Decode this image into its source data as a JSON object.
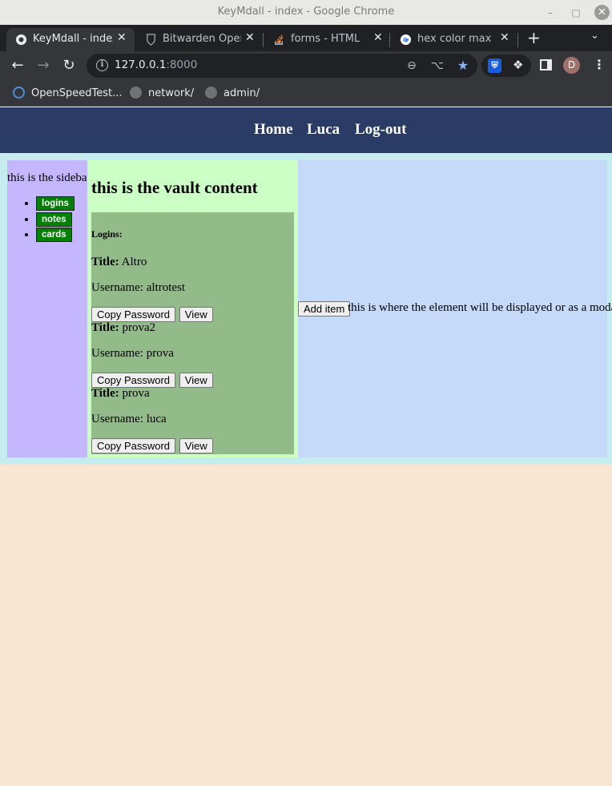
{
  "window": {
    "title": "KeyMdall - index - Google Chrome"
  },
  "tabs": [
    {
      "label": "KeyMdall - index",
      "icon": "globe-icon"
    },
    {
      "label": "Bitwarden Open",
      "icon": "bitwarden-shield-icon"
    },
    {
      "label": "forms - HTML St",
      "icon": "stackoverflow-icon"
    },
    {
      "label": "hex color max le",
      "icon": "google-icon"
    }
  ],
  "toolbar": {
    "url_host": "127.0.0.1",
    "url_port": ":8000",
    "avatar_initial": "D"
  },
  "bookmarks": [
    {
      "label": "OpenSpeedTest...",
      "icon": "openspeedtest-icon"
    },
    {
      "label": "network/",
      "icon": "globe-icon"
    },
    {
      "label": "admin/",
      "icon": "globe-icon"
    }
  ],
  "nav": {
    "links": [
      "Home",
      "Luca",
      "Log-out"
    ]
  },
  "sidebar": {
    "text": "this is the sidebar",
    "items": [
      "logins",
      "notes",
      "cards"
    ]
  },
  "vault": {
    "heading": "this is the vault content",
    "logins_label": "Logins:",
    "title_label": "Title:",
    "username_prefix": "Username: ",
    "copy_label": "Copy Password",
    "view_label": "View",
    "entries": [
      {
        "title": "Altro",
        "username": "altrotest"
      },
      {
        "title": "prova2",
        "username": "prova"
      },
      {
        "title": "prova",
        "username": "luca"
      }
    ]
  },
  "panel": {
    "add_label": "Add item",
    "text": "this is where the element will be displayed or as a modal"
  },
  "colors": {
    "nav_bg": "#2a3b66",
    "wrapper_bg": "#c5edf0",
    "sidebar_bg": "#c4b7fe",
    "content_bg": "#ccffc5",
    "logins_bg": "#93bb8a",
    "panel_bg": "#c5daf9",
    "page_bg": "#f8e6d3",
    "sidebar_button_bg": "#008000"
  }
}
